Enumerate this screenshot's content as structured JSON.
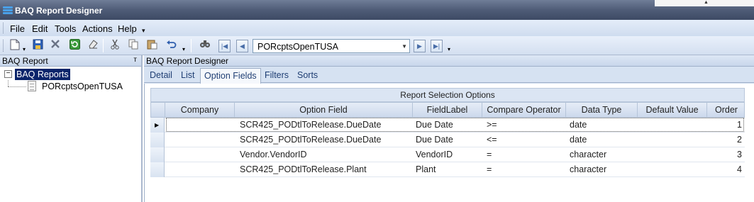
{
  "app": {
    "title": "BAQ Report Designer",
    "accent": "#0a246a"
  },
  "menu": {
    "items": [
      "File",
      "Edit",
      "Tools",
      "Actions",
      "Help"
    ]
  },
  "toolbar": {
    "icons": [
      "new-icon",
      "save-icon",
      "delete-icon",
      "refresh-icon",
      "clear-icon",
      "cut-icon",
      "copy-icon",
      "paste-icon",
      "undo-icon",
      "search-icon",
      "first-record-icon",
      "previous-record-icon",
      "next-record-icon",
      "last-record-icon"
    ],
    "record_value": "PORcptsOpenTUSA"
  },
  "left_pane": {
    "header": "BAQ Report",
    "pin_glyph": "Ɉ",
    "tree": {
      "root": "BAQ Reports",
      "children": [
        "PORcptsOpenTUSA"
      ]
    }
  },
  "right_pane": {
    "header": "BAQ Report Designer",
    "tabs": [
      "Detail",
      "List",
      "Option Fields",
      "Filters",
      "Sorts"
    ],
    "active_tab": "Option Fields"
  },
  "grid": {
    "group_header": "Report Selection Options",
    "columns": [
      "Company",
      "Option Field",
      "FieldLabel",
      "Compare Operator",
      "Data Type",
      "Default Value",
      "Order"
    ],
    "rows": [
      {
        "company": "",
        "option_field": "SCR425_PODtlToRelease.DueDate",
        "field_label": "Due Date",
        "compare": ">=",
        "data_type": "date",
        "default_value": "",
        "order": "1"
      },
      {
        "company": "",
        "option_field": "SCR425_PODtlToRelease.DueDate",
        "field_label": "Due Date",
        "compare": "<=",
        "data_type": "date",
        "default_value": "",
        "order": "2"
      },
      {
        "company": "",
        "option_field": "Vendor.VendorID",
        "field_label": "VendorID",
        "compare": "=",
        "data_type": "character",
        "default_value": "",
        "order": "3"
      },
      {
        "company": "",
        "option_field": "SCR425_PODtlToRelease.Plant",
        "field_label": "Plant",
        "compare": "=",
        "data_type": "character",
        "default_value": "",
        "order": "4"
      }
    ]
  }
}
